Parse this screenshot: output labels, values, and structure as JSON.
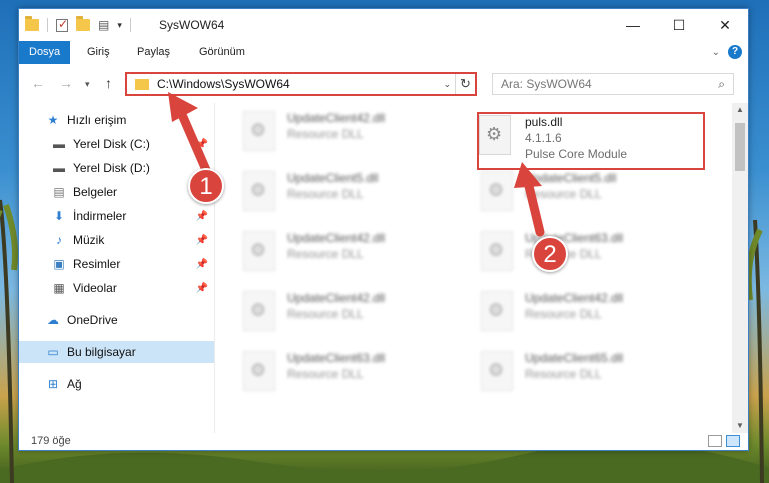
{
  "window": {
    "title": "SysWOW64"
  },
  "ribbon": {
    "tabs": [
      {
        "label": "Dosya"
      },
      {
        "label": "Giriş"
      },
      {
        "label": "Paylaş"
      },
      {
        "label": "Görünüm"
      }
    ]
  },
  "address": {
    "path": "C:\\Windows\\SysWOW64"
  },
  "search": {
    "placeholder": "Ara: SysWOW64"
  },
  "sidebar": {
    "items": [
      {
        "label": "Hızlı erişim",
        "icon": "star-icon"
      },
      {
        "label": "Yerel Disk (C:)",
        "icon": "drive-icon"
      },
      {
        "label": "Yerel Disk (D:)",
        "icon": "drive-icon"
      },
      {
        "label": "Belgeler",
        "icon": "document-icon"
      },
      {
        "label": "İndirmeler",
        "icon": "download-icon"
      },
      {
        "label": "Müzik",
        "icon": "music-icon"
      },
      {
        "label": "Resimler",
        "icon": "pictures-icon"
      },
      {
        "label": "Videolar",
        "icon": "video-icon"
      },
      {
        "label": "OneDrive",
        "icon": "cloud-icon"
      },
      {
        "label": "Bu bilgisayar",
        "icon": "computer-icon"
      },
      {
        "label": "Ağ",
        "icon": "network-icon"
      }
    ]
  },
  "files": {
    "left": [
      {
        "name": "UpdateClient42.dll",
        "desc": "Resource DLL"
      },
      {
        "name": "UpdateClient5.dll",
        "desc": "Resource DLL"
      },
      {
        "name": "UpdateClient42.dll",
        "desc": "Resource DLL"
      },
      {
        "name": "UpdateClient42.dll",
        "desc": "Resource DLL"
      },
      {
        "name": "UpdateClient63.dll",
        "desc": "Resource DLL"
      }
    ],
    "right": [
      {
        "name": "UpdateClient5.dll",
        "desc": "Resource DLL"
      },
      {
        "name": "UpdateClient63.dll",
        "desc": "Resource DLL"
      },
      {
        "name": "UpdateClient42.dll",
        "desc": "Resource DLL"
      },
      {
        "name": "UpdateClient65.dll",
        "desc": "Resource DLL"
      }
    ],
    "highlighted": {
      "name": "puls.dll",
      "version": "4.1.1.6",
      "desc": "Pulse Core Module"
    }
  },
  "status": {
    "count": "179 öğe"
  },
  "annotations": {
    "step1": "1",
    "step2": "2"
  },
  "colors": {
    "accent": "#1979ca",
    "annotation": "#d9453c"
  }
}
